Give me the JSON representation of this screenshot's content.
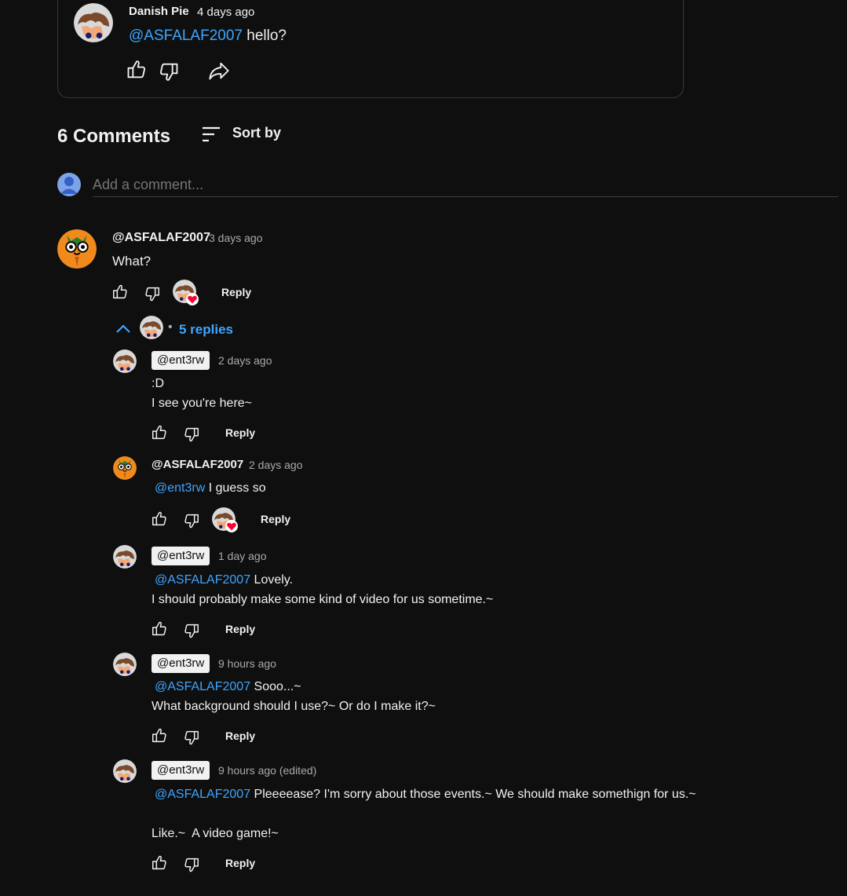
{
  "post": {
    "author": "Danish Pie",
    "time": "4 days ago",
    "mention": "@ASFALAF2007",
    "text": "hello?"
  },
  "comments_header": {
    "count_label": "6 Comments",
    "sort_label": "Sort by"
  },
  "add_comment": {
    "placeholder": "Add a comment..."
  },
  "top_comment": {
    "author": "@ASFALAF2007",
    "time": "3 days ago",
    "text": "What?",
    "reply_label": "Reply",
    "replies_label": "5 replies"
  },
  "replies": [
    {
      "author": "@ent3rw",
      "time": "2 days ago",
      "lines": [
        ":D",
        "I see you're here~"
      ],
      "reply_label": "Reply"
    },
    {
      "author": "@ASFALAF2007",
      "time": "2 days ago",
      "mention": "@ent3rw",
      "text": "I guess so",
      "reply_label": "Reply"
    },
    {
      "author": "@ent3rw",
      "time": "1 day ago",
      "mention": "@ASFALAF2007",
      "text": "Lovely.",
      "line2": "I should probably make some kind of video for us sometime.~",
      "reply_label": "Reply"
    },
    {
      "author": "@ent3rw",
      "time": "9 hours ago",
      "mention": "@ASFALAF2007",
      "text": "Sooo...~",
      "line2": "What background should I use?~ Or do I make it?~",
      "reply_label": "Reply"
    },
    {
      "author": "@ent3rw",
      "time": "9 hours ago (edited)",
      "mention": "@ASFALAF2007",
      "text": "Pleeeease? I'm sorry about those events.~ We should make somethign for us.~",
      "line2": "Like.~  A video game!~",
      "reply_label": "Reply"
    }
  ],
  "colors": {
    "background": "#0f0f0f",
    "link": "#3ea6ff",
    "heart": "#ff0033",
    "orange_avatar": "#f08a1c"
  }
}
